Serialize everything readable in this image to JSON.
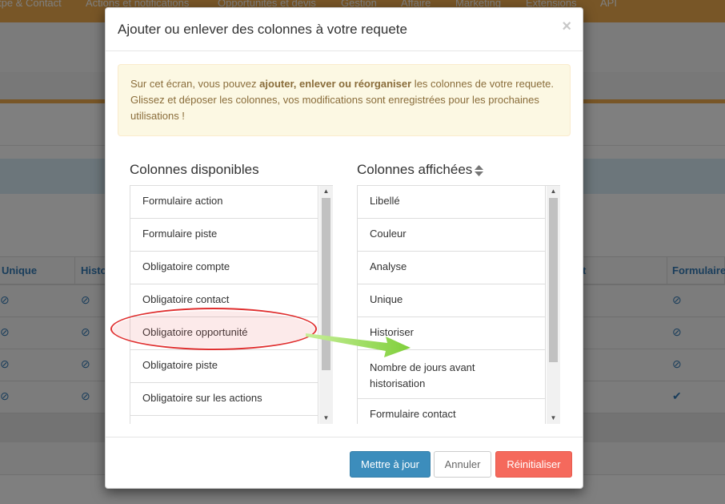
{
  "background": {
    "nav_items": [
      "tpe & Contact",
      "Actions et notifications",
      "Opportunités et devis",
      "Gestion",
      "Affaire",
      "Marketing",
      "Extensions",
      "API"
    ],
    "table_headers": [
      "Unique",
      "Histo",
      "t",
      "Formulaire"
    ],
    "rows": [
      {
        "c1": "⊘",
        "c2": "⊘",
        "c4": "⊘"
      },
      {
        "c1": "⊘",
        "c2": "⊘",
        "c4": "⊘"
      },
      {
        "c1": "⊘",
        "c2": "⊘",
        "c4": "⊘"
      },
      {
        "c1": "⊘",
        "c2": "⊘",
        "c4": "✔"
      }
    ]
  },
  "modal": {
    "title": "Ajouter ou enlever des colonnes à votre requete",
    "close_label": "×",
    "alert": {
      "prefix": "Sur cet écran, vous pouvez ",
      "bold": "ajouter, enlever ou réorganiser",
      "suffix": " les colonnes de votre requete. Glissez et déposer les colonnes, vos modifications sont enregistrées pour les prochaines utilisations !"
    },
    "available": {
      "title": "Colonnes disponibles",
      "items": [
        "Formulaire action",
        "Formulaire piste",
        "Obligatoire compte",
        "Obligatoire contact",
        "Obligatoire opportunité",
        "Obligatoire piste",
        "Obligatoire sur les actions",
        ""
      ]
    },
    "displayed": {
      "title": "Colonnes affichées",
      "items": [
        "Libellé",
        "Couleur",
        "Analyse",
        "Unique",
        "Historiser",
        "Nombre de jours avant historisation",
        "Formulaire contact"
      ]
    },
    "buttons": {
      "update": "Mettre à jour",
      "cancel": "Annuler",
      "reset": "Réinitialiser"
    },
    "colors": {
      "primary": "#3c8dbc",
      "danger": "#f5695c",
      "alert_bg": "#fcf8e3",
      "highlight": "#e03030",
      "arrow": "#8fd14f"
    }
  }
}
